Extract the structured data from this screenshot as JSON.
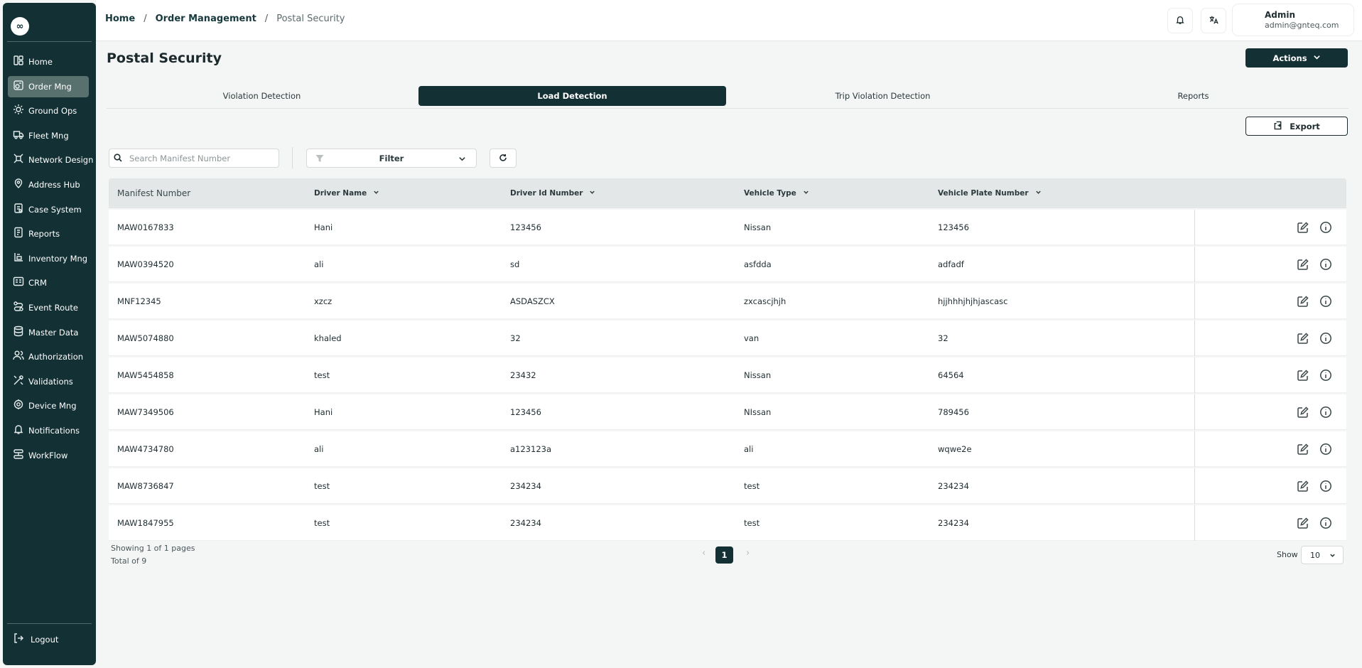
{
  "sidebar": {
    "logo_glyph": "∞",
    "items": [
      {
        "label": "Home",
        "icon": "home-icon",
        "active": false
      },
      {
        "label": "Order Mng",
        "icon": "order-icon",
        "active": true
      },
      {
        "label": "Ground Ops",
        "icon": "ground-ops-icon",
        "active": false
      },
      {
        "label": "Fleet Mng",
        "icon": "truck-icon",
        "active": false
      },
      {
        "label": "Network Design",
        "icon": "network-icon",
        "active": false
      },
      {
        "label": "Address Hub",
        "icon": "location-icon",
        "active": false
      },
      {
        "label": "Case System",
        "icon": "case-icon",
        "active": false
      },
      {
        "label": "Reports",
        "icon": "reports-icon",
        "active": false
      },
      {
        "label": "Inventory Mng",
        "icon": "inventory-icon",
        "active": false
      },
      {
        "label": "CRM",
        "icon": "crm-icon",
        "active": false
      },
      {
        "label": "Event Route",
        "icon": "route-icon",
        "active": false
      },
      {
        "label": "Master Data",
        "icon": "database-icon",
        "active": false
      },
      {
        "label": "Authorization",
        "icon": "users-icon",
        "active": false
      },
      {
        "label": "Validations",
        "icon": "tools-icon",
        "active": false
      },
      {
        "label": "Device Mng",
        "icon": "device-icon",
        "active": false
      },
      {
        "label": "Notifications",
        "icon": "bell-icon",
        "active": false
      },
      {
        "label": "WorkFlow",
        "icon": "workflow-icon",
        "active": false
      }
    ],
    "logout_label": "Logout"
  },
  "breadcrumb": {
    "items": [
      "Home",
      "Order Management"
    ],
    "current": "Postal Security"
  },
  "user": {
    "name": "Admin",
    "email": "admin@gnteq.com"
  },
  "page": {
    "title": "Postal Security",
    "actions_label": "Actions",
    "export_label": "Export"
  },
  "tabs": [
    {
      "label": "Violation Detection",
      "active": false
    },
    {
      "label": "Load Detection",
      "active": true
    },
    {
      "label": "Trip Violation Detection",
      "active": false
    },
    {
      "label": "Reports",
      "active": false
    }
  ],
  "toolbar": {
    "search_placeholder": "Search Manifest Number",
    "filter_label": "Filter"
  },
  "table": {
    "columns": [
      "Manifest Number",
      "Driver Name",
      "Driver Id Number",
      "Vehicle Type",
      "Vehicle Plate Number"
    ],
    "rows": [
      [
        "MAW0167833",
        "Hani",
        "123456",
        "Nissan",
        "123456"
      ],
      [
        "MAW0394520",
        "ali",
        "sd",
        "asfdda",
        "adfadf"
      ],
      [
        "MNF12345",
        "xzcz",
        "ASDASZCX",
        "zxcascjhjh",
        "hjjhhhjhjhjascasc"
      ],
      [
        "MAW5074880",
        "khaled",
        "32",
        "van",
        "32"
      ],
      [
        "MAW5454858",
        "test",
        "23432",
        "Nissan",
        "64564"
      ],
      [
        "MAW7349506",
        "Hani",
        "123456",
        "NIssan",
        "789456"
      ],
      [
        "MAW4734780",
        "ali",
        "a123123a",
        "ali",
        "wqwe2e"
      ],
      [
        "MAW8736847",
        "test",
        "234234",
        "test",
        "234234"
      ],
      [
        "MAW1847955",
        "test",
        "234234",
        "test",
        "234234"
      ]
    ]
  },
  "pagination": {
    "showing_text": "Showing 1 of 1 pages",
    "total_text": "Total of 9",
    "prev_glyph": "‹",
    "next_glyph": "›",
    "current_page": "1",
    "show_label": "Show",
    "page_size": "10"
  },
  "colors": {
    "sidebar_bg": "#133034",
    "accent": "#133034",
    "active_nav": "#58716f",
    "header_row": "#e3e7e7",
    "page_bg": "#f4f5f5"
  }
}
